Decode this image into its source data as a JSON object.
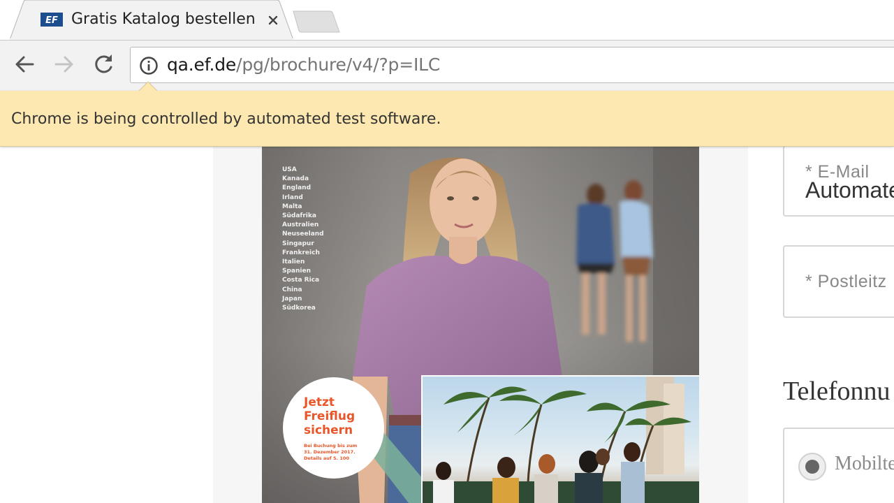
{
  "browser": {
    "tab": {
      "title": "Gratis Katalog bestellen",
      "favicon": "ef-logo-icon",
      "favicon_text": "EF"
    },
    "url": {
      "host": "qa.ef.de",
      "path": "/pg/brochure/v4/?p=ILC"
    },
    "infobar": {
      "message": "Chrome is being controlled by automated test software."
    }
  },
  "brochure": {
    "countries": [
      "USA",
      "Kanada",
      "England",
      "Irland",
      "Malta",
      "Südafrika",
      "Australien",
      "Neuseeland",
      "Singapur",
      "Frankreich",
      "Italien",
      "Spanien",
      "Costa Rica",
      "China",
      "Japan",
      "Südkorea"
    ],
    "sticker": {
      "title": "Jetzt\nFreiflug\nsichern",
      "note": "Bei Buchung bis zum\n31. Dezember 2017.\nDetails auf S. 100",
      "color": "#e8562a"
    }
  },
  "form": {
    "email": {
      "label": "* E-Mail",
      "value": "Automate"
    },
    "postal": {
      "label": "* Postleitz"
    },
    "phone": {
      "title": "Telefonnu",
      "option_label": "Mobilte",
      "selected": true
    }
  },
  "colors": {
    "infobar_bg": "#fde8b1",
    "toolbar_bg": "#f2f2f2",
    "accent_orange": "#e8562a"
  }
}
